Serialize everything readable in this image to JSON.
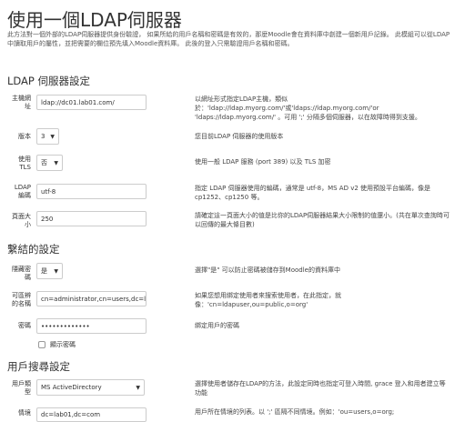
{
  "page": {
    "title": "使用一個LDAP伺服器",
    "intro": "此方法對一個外部的LDAP伺服器提供身份驗證， 如果所給的用戶名稱和密碼是有效的，那麼Moodle會在資料庫中創建一個新用戶記錄。 此模組可以從LDAP中讀取用戶的屬性，並把需要的欄位預先填入Moodle資料庫。 此後的登入只需驗證用戶名稱和密碼。"
  },
  "sections": {
    "server": {
      "heading": "LDAP 伺服器設定",
      "host": {
        "label": "主機網址",
        "value": "ldap://dc01.lab01.com/",
        "desc": "以網址形式指定LDAP主機，類似 於：'ldap://ldap.myorg.com/'或'ldaps://ldap.myorg.com/'or 'ldaps://ldap.myorg.com/' 。可用 ';' 分隔多個伺服器，以在故障時得到支援。"
      },
      "version": {
        "label": "版本",
        "value": "3",
        "desc": "您目前LDAP 伺服器的使用版本"
      },
      "tls": {
        "label": "使用 TLS",
        "value": "否",
        "desc": "使用一般 LDAP 服務 (port 389) 以及 TLS 加密"
      },
      "encoding": {
        "label": "LDAP 編碼",
        "value": "utf-8",
        "desc": "指定 LDAP 伺服器使用的編碼，通常是 utf-8，MS AD v2 使用預設平台編碼，像是 cp1252、cp1250 等。"
      },
      "pagesize": {
        "label": "頁面大小",
        "value": "250",
        "desc": "請確定這一頁面大小的值是比你的LDAP伺服器結果大小限制的值還小。(共在單次查詢時可以回傳的最大條目數)"
      }
    },
    "bind": {
      "heading": "繫結的設定",
      "preventpassaccess": {
        "label": "隱藏密碼",
        "value": "是",
        "desc": "選擇\"是\" 可以防止密碼被儲存到Moodle的資料庫中"
      },
      "binddn": {
        "label": "可區辨的名稱",
        "value": "cn=administrator,cn=users,dc=lab",
        "desc": "如果您想用綁定使用者來搜索使用者，在此指定，就像：'cn=ldapuser,ou=public,o=org'"
      },
      "bindpw": {
        "label": "密碼",
        "value": "•••••••••••••",
        "desc": "綁定用戶的密碼"
      },
      "unmask": {
        "label": "顯示密碼"
      }
    },
    "lookup": {
      "heading": "用戶搜尋設定",
      "usertype": {
        "label": "用戶類型",
        "value": "MS ActiveDirectory",
        "desc": "選擇使用者儲存在LDAP的方法，此設定同時也指定可登入時間, grace 登入和用者建立等功能"
      },
      "contexts": {
        "label": "情境",
        "value": "dc=lab01,dc=com",
        "desc": "用戶所在情境的列表。以 ';' 區隔不同情境。例如：'ou=users,o=org;"
      }
    }
  }
}
